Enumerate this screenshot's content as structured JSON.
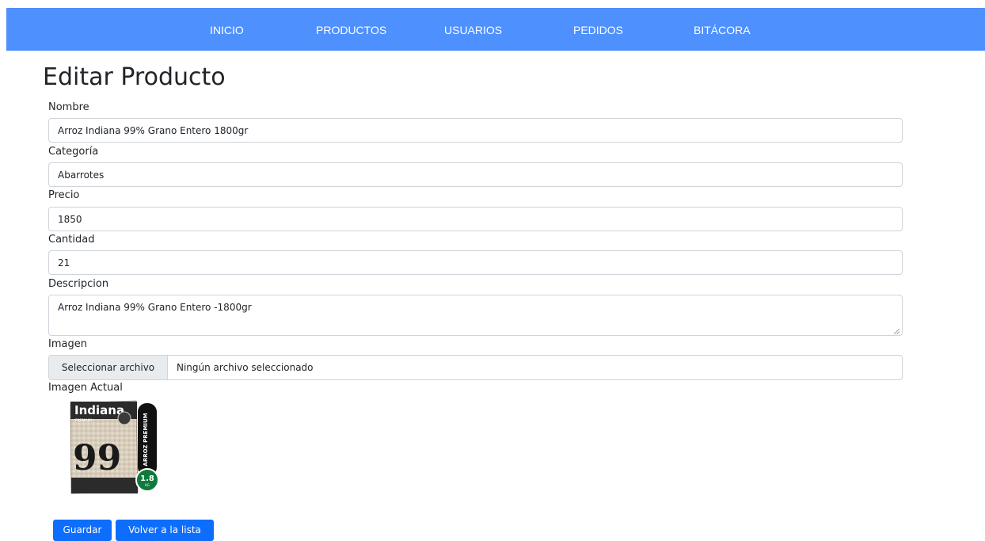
{
  "nav": {
    "items": [
      {
        "label": "INICIO"
      },
      {
        "label": "PRODUCTOS"
      },
      {
        "label": "USUARIOS"
      },
      {
        "label": "PEDIDOS"
      },
      {
        "label": "BITÁCORA"
      }
    ]
  },
  "page": {
    "title": "Editar Producto"
  },
  "form": {
    "nombre": {
      "label": "Nombre",
      "value": "Arroz Indiana 99% Grano Entero 1800gr"
    },
    "categoria": {
      "label": "Categoría",
      "value": "Abarrotes"
    },
    "precio": {
      "label": "Precio",
      "value": "1850"
    },
    "cantidad": {
      "label": "Cantidad",
      "value": "21"
    },
    "descripcion": {
      "label": "Descripcion",
      "value": "Arroz Indiana 99% Grano Entero -1800gr"
    },
    "imagen": {
      "label": "Imagen",
      "button_label": "Seleccionar archivo",
      "status": "Ningún archivo seleccionado"
    },
    "imagen_actual": {
      "label": "Imagen Actual",
      "brand": "Indiana",
      "sub_brand": "PREMIUM",
      "big_number": "99",
      "side_text": "ARROZ PREMIUM",
      "weight_value": "1.8",
      "weight_unit": "KG"
    }
  },
  "actions": {
    "save_label": "Guardar",
    "back_label": "Volver a la lista"
  },
  "colors": {
    "navbar": "#4d90fe",
    "primary_button": "#0d6efd",
    "badge_green": "#0f7a3c"
  }
}
